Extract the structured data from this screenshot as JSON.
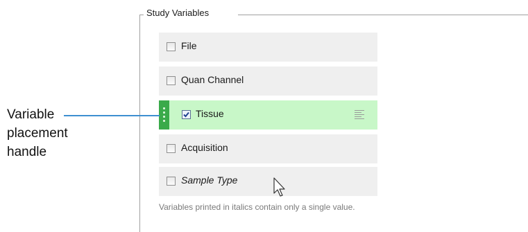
{
  "group": {
    "title": "Study Variables"
  },
  "variables": [
    {
      "label": "File",
      "checked": false,
      "italic": false,
      "selected": false
    },
    {
      "label": "Quan Channel",
      "checked": false,
      "italic": false,
      "selected": false
    },
    {
      "label": "Tissue",
      "checked": true,
      "italic": false,
      "selected": true
    },
    {
      "label": "Acquisition",
      "checked": false,
      "italic": false,
      "selected": false
    },
    {
      "label": "Sample Type",
      "checked": false,
      "italic": true,
      "selected": false
    }
  ],
  "footnote": "Variables printed in italics contain only a single value.",
  "callout": {
    "text": "Variable placement handle"
  },
  "colors": {
    "selected_row": "#c8f7c8",
    "handle": "#3aaa4a",
    "callout_line": "#3d8fd0",
    "row": "#efefef"
  },
  "icons": {
    "handle": "drag-handle-icon",
    "order": "sort-order-icon",
    "cursor": "arrow-cursor-icon"
  }
}
